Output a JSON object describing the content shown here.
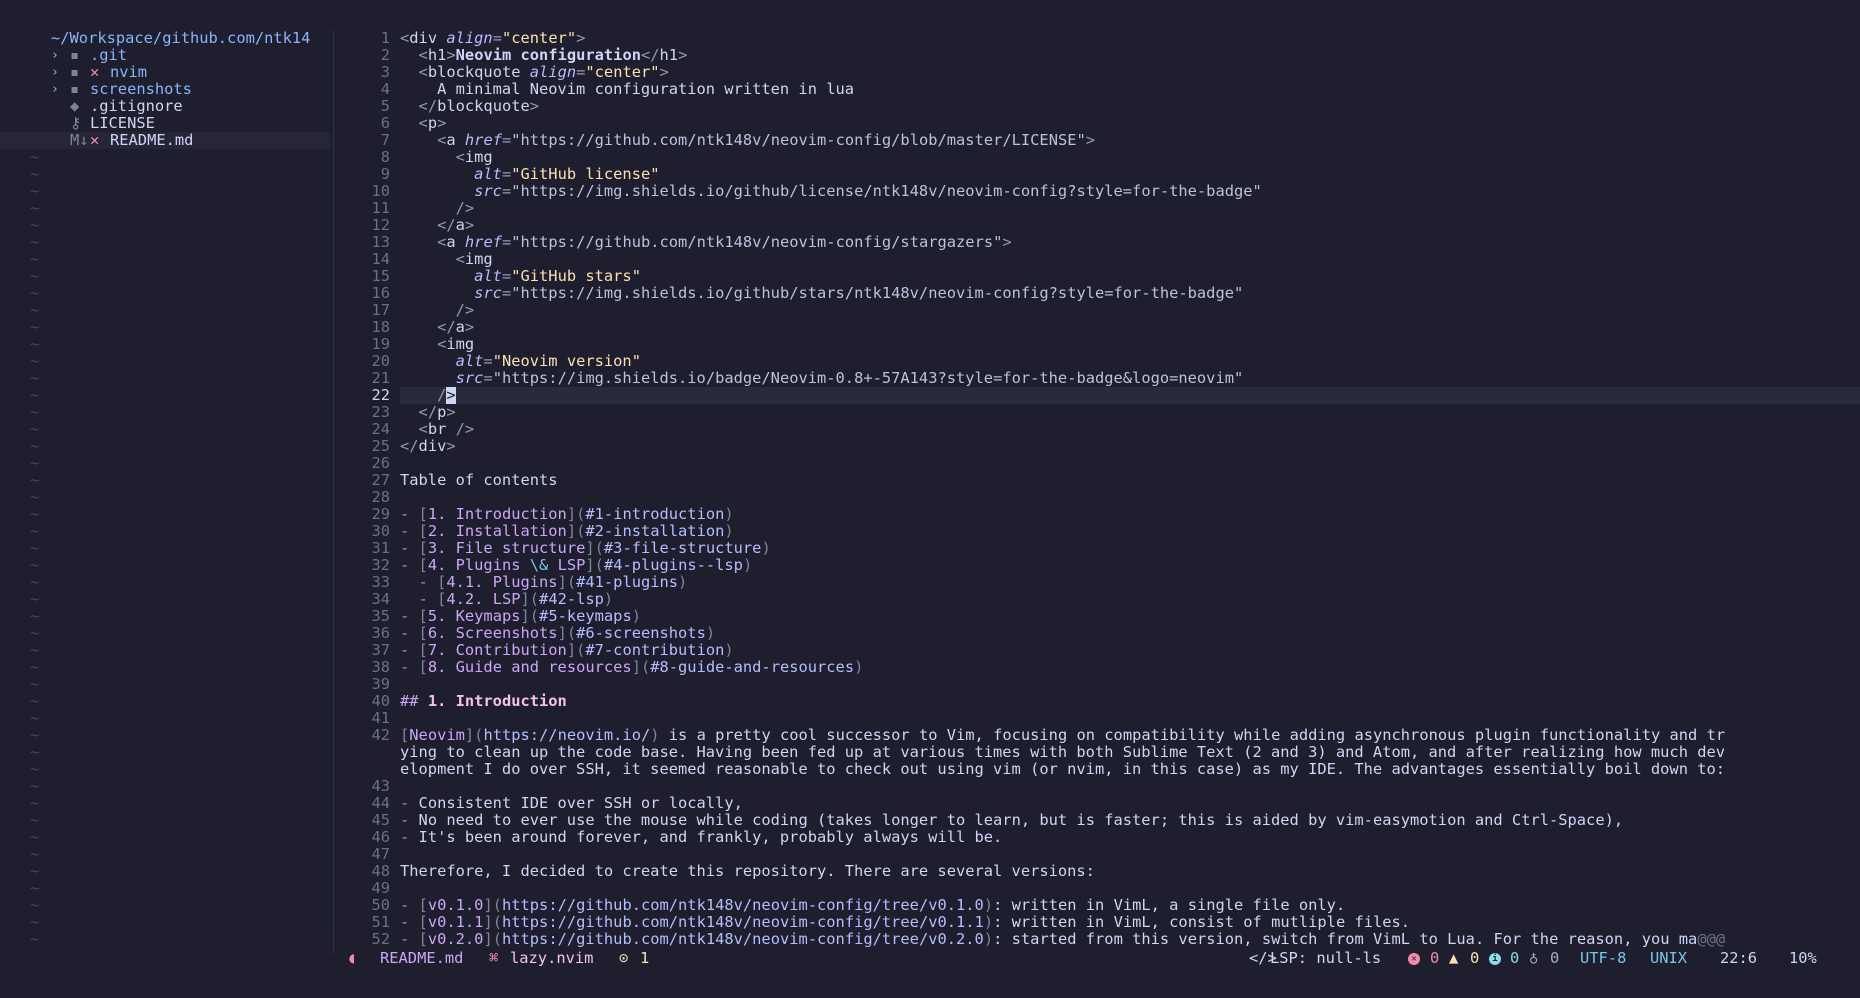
{
  "tree": {
    "root": "~/Workspace/github.com/ntk14",
    "items": [
      {
        "name": ".git",
        "chevron": "›",
        "icon": "▪",
        "git_mark": "",
        "kind": "dir"
      },
      {
        "name": "nvim",
        "chevron": "›",
        "icon": "▪",
        "git_mark": "✕",
        "kind": "dir"
      },
      {
        "name": "screenshots",
        "chevron": "›",
        "icon": "▪",
        "git_mark": "",
        "kind": "dir"
      },
      {
        "name": ".gitignore",
        "chevron": "",
        "icon": "◆",
        "git_mark": "",
        "kind": "file"
      },
      {
        "name": "LICENSE",
        "chevron": "",
        "icon": "⚷",
        "git_mark": "",
        "kind": "file"
      },
      {
        "name": "README.md",
        "chevron": "",
        "icon": "M↓",
        "git_mark": "✕",
        "kind": "file",
        "selected": true
      }
    ],
    "filler": "~"
  },
  "editor": {
    "current_line": 22,
    "lines": [
      {
        "n": "1",
        "segs": [
          [
            "pu",
            "<"
          ],
          [
            "tag",
            "div "
          ],
          [
            "attr",
            "align"
          ],
          [
            "pu",
            "="
          ],
          [
            "str",
            "\"center\""
          ],
          [
            "pu",
            ">"
          ]
        ]
      },
      {
        "n": "2",
        "segs": [
          [
            "txt",
            "  "
          ],
          [
            "pu",
            "<"
          ],
          [
            "tag",
            "h1"
          ],
          [
            "pu",
            ">"
          ],
          [
            "bold",
            "Neovim configuration"
          ],
          [
            "pu",
            "</"
          ],
          [
            "tag",
            "h1"
          ],
          [
            "pu",
            ">"
          ]
        ]
      },
      {
        "n": "3",
        "segs": [
          [
            "txt",
            "  "
          ],
          [
            "pu",
            "<"
          ],
          [
            "tag",
            "blockquote "
          ],
          [
            "attr",
            "align"
          ],
          [
            "pu",
            "="
          ],
          [
            "str",
            "\"center\""
          ],
          [
            "pu",
            ">"
          ]
        ]
      },
      {
        "n": "4",
        "segs": [
          [
            "txt",
            "    A minimal Neovim configuration written in lua"
          ]
        ]
      },
      {
        "n": "5",
        "segs": [
          [
            "txt",
            "  "
          ],
          [
            "pu",
            "</"
          ],
          [
            "tag",
            "blockquote"
          ],
          [
            "pu",
            ">"
          ]
        ]
      },
      {
        "n": "6",
        "segs": [
          [
            "txt",
            "  "
          ],
          [
            "pu",
            "<"
          ],
          [
            "tag",
            "p"
          ],
          [
            "pu",
            ">"
          ]
        ]
      },
      {
        "n": "7",
        "segs": [
          [
            "txt",
            "    "
          ],
          [
            "pu",
            "<"
          ],
          [
            "tag",
            "a "
          ],
          [
            "attr",
            "href"
          ],
          [
            "pu",
            "="
          ],
          [
            "url",
            "\"https://github.com/ntk148v/neovim-config/blob/master/LICENSE\""
          ],
          [
            "pu",
            ">"
          ]
        ]
      },
      {
        "n": "8",
        "segs": [
          [
            "txt",
            "      "
          ],
          [
            "pu",
            "<"
          ],
          [
            "tag",
            "img"
          ]
        ]
      },
      {
        "n": "9",
        "segs": [
          [
            "txt",
            "        "
          ],
          [
            "attr",
            "alt"
          ],
          [
            "pu",
            "="
          ],
          [
            "str",
            "\"GitHub license\""
          ]
        ]
      },
      {
        "n": "10",
        "segs": [
          [
            "txt",
            "        "
          ],
          [
            "attr",
            "src"
          ],
          [
            "pu",
            "="
          ],
          [
            "url",
            "\"https://img.shields.io/github/license/ntk148v/neovim-config?style=for-the-badge\""
          ]
        ]
      },
      {
        "n": "11",
        "segs": [
          [
            "txt",
            "      "
          ],
          [
            "pu",
            "/>"
          ]
        ]
      },
      {
        "n": "12",
        "segs": [
          [
            "txt",
            "    "
          ],
          [
            "pu",
            "</"
          ],
          [
            "tag",
            "a"
          ],
          [
            "pu",
            ">"
          ]
        ]
      },
      {
        "n": "13",
        "segs": [
          [
            "txt",
            "    "
          ],
          [
            "pu",
            "<"
          ],
          [
            "tag",
            "a "
          ],
          [
            "attr",
            "href"
          ],
          [
            "pu",
            "="
          ],
          [
            "url",
            "\"https://github.com/ntk148v/neovim-config/stargazers\""
          ],
          [
            "pu",
            ">"
          ]
        ]
      },
      {
        "n": "14",
        "segs": [
          [
            "txt",
            "      "
          ],
          [
            "pu",
            "<"
          ],
          [
            "tag",
            "img"
          ]
        ]
      },
      {
        "n": "15",
        "segs": [
          [
            "txt",
            "        "
          ],
          [
            "attr",
            "alt"
          ],
          [
            "pu",
            "="
          ],
          [
            "str",
            "\"GitHub stars\""
          ]
        ]
      },
      {
        "n": "16",
        "segs": [
          [
            "txt",
            "        "
          ],
          [
            "attr",
            "src"
          ],
          [
            "pu",
            "="
          ],
          [
            "url",
            "\"https://img.shields.io/github/stars/ntk148v/neovim-config?style=for-the-badge\""
          ]
        ]
      },
      {
        "n": "17",
        "segs": [
          [
            "txt",
            "      "
          ],
          [
            "pu",
            "/>"
          ]
        ]
      },
      {
        "n": "18",
        "segs": [
          [
            "txt",
            "    "
          ],
          [
            "pu",
            "</"
          ],
          [
            "tag",
            "a"
          ],
          [
            "pu",
            ">"
          ]
        ]
      },
      {
        "n": "19",
        "segs": [
          [
            "txt",
            "    "
          ],
          [
            "pu",
            "<"
          ],
          [
            "tag",
            "img"
          ]
        ]
      },
      {
        "n": "20",
        "segs": [
          [
            "txt",
            "      "
          ],
          [
            "attr",
            "alt"
          ],
          [
            "pu",
            "="
          ],
          [
            "str",
            "\"Neovim version\""
          ]
        ]
      },
      {
        "n": "21",
        "segs": [
          [
            "txt",
            "      "
          ],
          [
            "attr",
            "src"
          ],
          [
            "pu",
            "="
          ],
          [
            "url",
            "\"https://img.shields.io/badge/Neovim-0.8+-57A143?style=for-the-badge&logo=neovim\""
          ]
        ]
      },
      {
        "n": "22",
        "segs": [
          [
            "txt",
            "    "
          ],
          [
            "pu",
            "/"
          ],
          [
            "cursor",
            ">"
          ]
        ]
      },
      {
        "n": "23",
        "segs": [
          [
            "txt",
            "  "
          ],
          [
            "pu",
            "</"
          ],
          [
            "tag",
            "p"
          ],
          [
            "pu",
            ">"
          ]
        ]
      },
      {
        "n": "24",
        "segs": [
          [
            "txt",
            "  "
          ],
          [
            "pu",
            "<"
          ],
          [
            "tag",
            "br "
          ],
          [
            "pu",
            "/>"
          ]
        ]
      },
      {
        "n": "25",
        "segs": [
          [
            "pu",
            "</"
          ],
          [
            "tag",
            "div"
          ],
          [
            "pu",
            ">"
          ]
        ]
      },
      {
        "n": "26",
        "segs": []
      },
      {
        "n": "27",
        "segs": [
          [
            "txt",
            "Table of contents"
          ]
        ]
      },
      {
        "n": "28",
        "segs": []
      },
      {
        "n": "29",
        "segs": [
          [
            "dash",
            "- "
          ],
          [
            "br",
            "["
          ],
          [
            "link",
            "1. Introduction"
          ],
          [
            "br",
            "]("
          ],
          [
            "anc",
            "#1-introduction"
          ],
          [
            "br",
            ")"
          ]
        ]
      },
      {
        "n": "30",
        "segs": [
          [
            "dash",
            "- "
          ],
          [
            "br",
            "["
          ],
          [
            "link",
            "2. Installation"
          ],
          [
            "br",
            "]("
          ],
          [
            "anc",
            "#2-installation"
          ],
          [
            "br",
            ")"
          ]
        ]
      },
      {
        "n": "31",
        "segs": [
          [
            "dash",
            "- "
          ],
          [
            "br",
            "["
          ],
          [
            "link",
            "3. File structure"
          ],
          [
            "br",
            "]("
          ],
          [
            "anc",
            "#3-file-structure"
          ],
          [
            "br",
            ")"
          ]
        ]
      },
      {
        "n": "32",
        "segs": [
          [
            "dash",
            "- "
          ],
          [
            "br",
            "["
          ],
          [
            "link",
            "4. Plugins "
          ],
          [
            "esc",
            "\\&"
          ],
          [
            "link",
            " LSP"
          ],
          [
            "br",
            "]("
          ],
          [
            "anc",
            "#4-plugins--lsp"
          ],
          [
            "br",
            ")"
          ]
        ]
      },
      {
        "n": "33",
        "segs": [
          [
            "dash",
            "  - "
          ],
          [
            "br",
            "["
          ],
          [
            "link",
            "4.1. Plugins"
          ],
          [
            "br",
            "]("
          ],
          [
            "anc",
            "#41-plugins"
          ],
          [
            "br",
            ")"
          ]
        ]
      },
      {
        "n": "34",
        "segs": [
          [
            "dash",
            "  - "
          ],
          [
            "br",
            "["
          ],
          [
            "link",
            "4.2. LSP"
          ],
          [
            "br",
            "]("
          ],
          [
            "anc",
            "#42-lsp"
          ],
          [
            "br",
            ")"
          ]
        ]
      },
      {
        "n": "35",
        "segs": [
          [
            "dash",
            "- "
          ],
          [
            "br",
            "["
          ],
          [
            "link",
            "5. Keymaps"
          ],
          [
            "br",
            "]("
          ],
          [
            "anc",
            "#5-keymaps"
          ],
          [
            "br",
            ")"
          ]
        ]
      },
      {
        "n": "36",
        "segs": [
          [
            "dash",
            "- "
          ],
          [
            "br",
            "["
          ],
          [
            "link",
            "6. Screenshots"
          ],
          [
            "br",
            "]("
          ],
          [
            "anc",
            "#6-screenshots"
          ],
          [
            "br",
            ")"
          ]
        ]
      },
      {
        "n": "37",
        "segs": [
          [
            "dash",
            "- "
          ],
          [
            "br",
            "["
          ],
          [
            "link",
            "7. Contribution"
          ],
          [
            "br",
            "]("
          ],
          [
            "anc",
            "#7-contribution"
          ],
          [
            "br",
            ")"
          ]
        ]
      },
      {
        "n": "38",
        "segs": [
          [
            "dash",
            "- "
          ],
          [
            "br",
            "["
          ],
          [
            "link",
            "8. Guide and resources"
          ],
          [
            "br",
            "]("
          ],
          [
            "anc",
            "#8-guide-and-resources"
          ],
          [
            "br",
            ")"
          ]
        ]
      },
      {
        "n": "39",
        "segs": []
      },
      {
        "n": "40",
        "segs": [
          [
            "h",
            "## "
          ],
          [
            "h1",
            "1. Introduction"
          ]
        ]
      },
      {
        "n": "41",
        "segs": []
      },
      {
        "n": "42",
        "segs": [
          [
            "br",
            "["
          ],
          [
            "link",
            "Neovim"
          ],
          [
            "br",
            "]("
          ],
          [
            "anc",
            "https://neovim.io/"
          ],
          [
            "br",
            ")"
          ],
          [
            "txt",
            " is a pretty cool successor to Vim, focusing on compatibility while adding asynchronous plugin functionality and tr"
          ]
        ]
      },
      {
        "n": "",
        "segs": [
          [
            "txt",
            "ying to clean up the code base. Having been fed up at various times with both Sublime Text (2 and 3) and Atom, and after realizing how much dev"
          ]
        ]
      },
      {
        "n": "",
        "segs": [
          [
            "txt",
            "elopment I do over SSH, it seemed reasonable to check out using vim (or nvim, in this case) as my IDE. The advantages essentially boil down to:"
          ]
        ]
      },
      {
        "n": "43",
        "segs": []
      },
      {
        "n": "44",
        "segs": [
          [
            "dash",
            "- "
          ],
          [
            "txt",
            "Consistent IDE over SSH or locally,"
          ]
        ]
      },
      {
        "n": "45",
        "segs": [
          [
            "dash",
            "- "
          ],
          [
            "txt",
            "No need to ever use the mouse while coding (takes longer to learn, but is faster; this is aided by vim-easymotion and Ctrl-Space),"
          ]
        ]
      },
      {
        "n": "46",
        "segs": [
          [
            "dash",
            "- "
          ],
          [
            "txt",
            "It's been around forever, and frankly, probably always will be."
          ]
        ]
      },
      {
        "n": "47",
        "segs": []
      },
      {
        "n": "48",
        "segs": [
          [
            "txt",
            "Therefore, I decided to create this repository. There are several versions:"
          ]
        ]
      },
      {
        "n": "49",
        "segs": []
      },
      {
        "n": "50",
        "segs": [
          [
            "dash",
            "- "
          ],
          [
            "br",
            "["
          ],
          [
            "link",
            "v0.1.0"
          ],
          [
            "br",
            "]("
          ],
          [
            "anc",
            "https://github.com/ntk148v/neovim-config/tree/v0.1.0"
          ],
          [
            "br",
            ")"
          ],
          [
            "txt",
            ": written in VimL, a single file only."
          ]
        ]
      },
      {
        "n": "51",
        "segs": [
          [
            "dash",
            "- "
          ],
          [
            "br",
            "["
          ],
          [
            "link",
            "v0.1.1"
          ],
          [
            "br",
            "]("
          ],
          [
            "anc",
            "https://github.com/ntk148v/neovim-config/tree/v0.1.1"
          ],
          [
            "br",
            ")"
          ],
          [
            "txt",
            ": written in VimL, consist of mutliple files."
          ]
        ]
      },
      {
        "n": "52",
        "segs": [
          [
            "dash",
            "- "
          ],
          [
            "br",
            "["
          ],
          [
            "link",
            "v0.2.0"
          ],
          [
            "br",
            "]("
          ],
          [
            "anc",
            "https://github.com/ntk148v/neovim-config/tree/v0.2.0"
          ],
          [
            "br",
            ")"
          ],
          [
            "txt",
            ": started from this version, switch from VimL to Lua. For the reason, you ma"
          ],
          [
            "dim",
            "@@@"
          ]
        ]
      }
    ]
  },
  "statusline": {
    "ghost_icon": "◖",
    "file": "README.md",
    "lazy_icon": "⌘",
    "lazy_label": "lazy.nvim",
    "updates_icon": "⊙",
    "updates_count": "1",
    "lsp_icon": "</>",
    "lsp_label": "LSP: null-ls",
    "errors": "0",
    "warnings": "0",
    "info": "0",
    "hints": "0",
    "encoding": "UTF-8",
    "fileformat": "UNIX",
    "position": "22:6",
    "percent": "10%"
  }
}
